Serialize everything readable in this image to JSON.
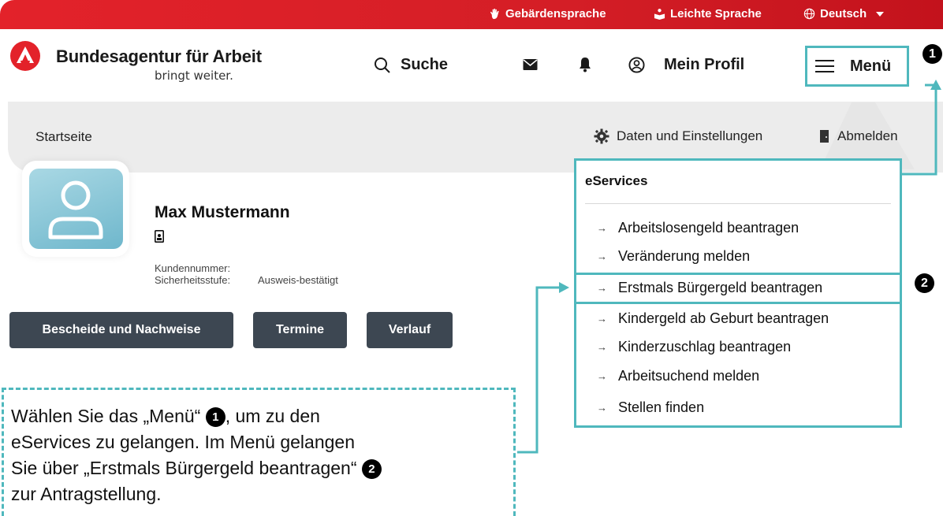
{
  "topbar": {
    "sign_language": "Gebärdensprache",
    "easy_language": "Leichte Sprache",
    "language": "Deutsch"
  },
  "header": {
    "brand_title": "Bundesagentur für Arbeit",
    "brand_subtitle": "bringt weiter.",
    "search_label": "Suche",
    "profile_label": "Mein Profil",
    "menu_label": "Menü"
  },
  "band": {
    "breadcrumb": "Startseite",
    "settings_label": "Daten und Einstellungen",
    "logout_label": "Abmelden"
  },
  "profile": {
    "name": "Max Mustermann",
    "customer_number_label": "Kundennummer:",
    "security_level_label": "Sicherheitsstufe:",
    "security_level_value": "Ausweis-bestätigt"
  },
  "buttons": {
    "documents": "Bescheide und Nachweise",
    "appointments": "Termine",
    "history": "Verlauf"
  },
  "menu_panel": {
    "title": "eServices",
    "items": [
      "Arbeitslosengeld beantragen",
      "Veränderung melden",
      "Erstmals Bürgergeld beantragen",
      "Kindergeld ab Geburt beantragen",
      "Kinderzuschlag beantragen",
      "Arbeitsuchend melden",
      "Stellen finden"
    ],
    "arrow": "→"
  },
  "annotations": {
    "num1": "1",
    "num2": "2",
    "accent_color": "#4fb8bd"
  },
  "callout": {
    "line1a": "Wählen Sie das „Menü“",
    "line1b": ", um zu den",
    "line2": "eServices zu gelangen. Im Menü gelangen",
    "line3": "Sie über „Erstmals Bürgergeld beantragen“",
    "line4": "zur Antragstellung."
  }
}
